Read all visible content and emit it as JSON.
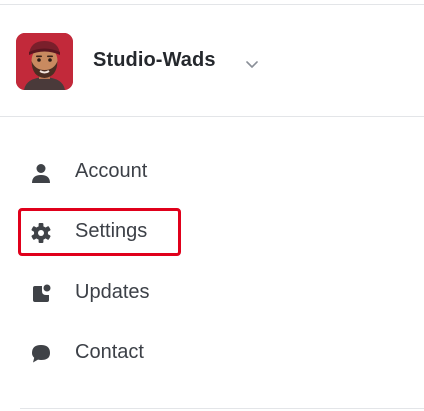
{
  "header": {
    "org_name": "Studio-Wads",
    "avatar_icon": "memoji-avatar-icon",
    "dropdown_icon": "chevron-down-icon"
  },
  "menu": {
    "items": [
      {
        "label": "Account",
        "icon": "person-icon"
      },
      {
        "label": "Settings",
        "icon": "gear-icon"
      },
      {
        "label": "Updates",
        "icon": "updates-icon"
      },
      {
        "label": "Contact",
        "icon": "chat-bubble-icon"
      }
    ]
  },
  "colors": {
    "highlight": "#e0001b",
    "icon": "#3f4247",
    "text": "#3c4047",
    "avatar_bg": "#c2293a"
  }
}
